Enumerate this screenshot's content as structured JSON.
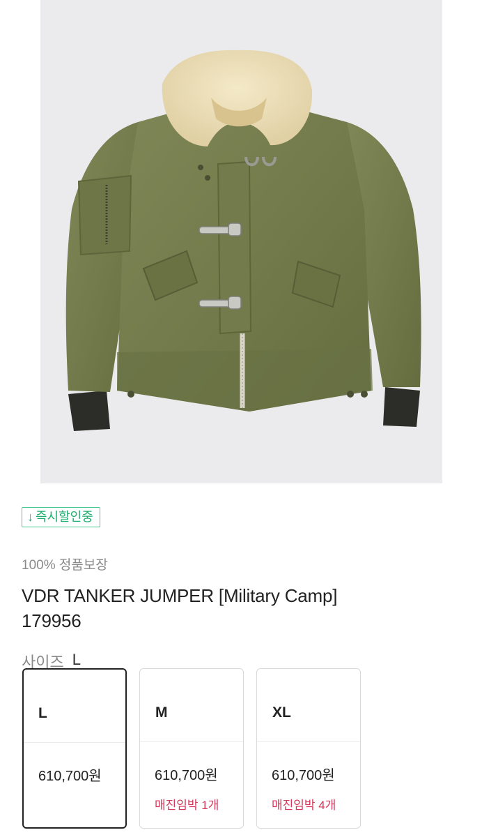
{
  "product": {
    "badge": {
      "icon": "down-arrow-icon",
      "text": "즉시할인중",
      "color": "#1fae6f"
    },
    "guarantee": "100% 정품보장",
    "title_line1": "VDR TANKER JUMPER [Military Camp]",
    "title_line2": "179956",
    "image_subject": "olive military tanker jacket with sherpa collar"
  },
  "size": {
    "label": "사이즈",
    "selected": "L",
    "options": [
      {
        "size": "L",
        "price": "610,700원",
        "stock_note": "",
        "selected": true
      },
      {
        "size": "M",
        "price": "610,700원",
        "stock_note": "매진임박 1개",
        "selected": false
      },
      {
        "size": "XL",
        "price": "610,700원",
        "stock_note": "매진임박 4개",
        "selected": false
      }
    ],
    "stock_color": "#d6375a"
  }
}
